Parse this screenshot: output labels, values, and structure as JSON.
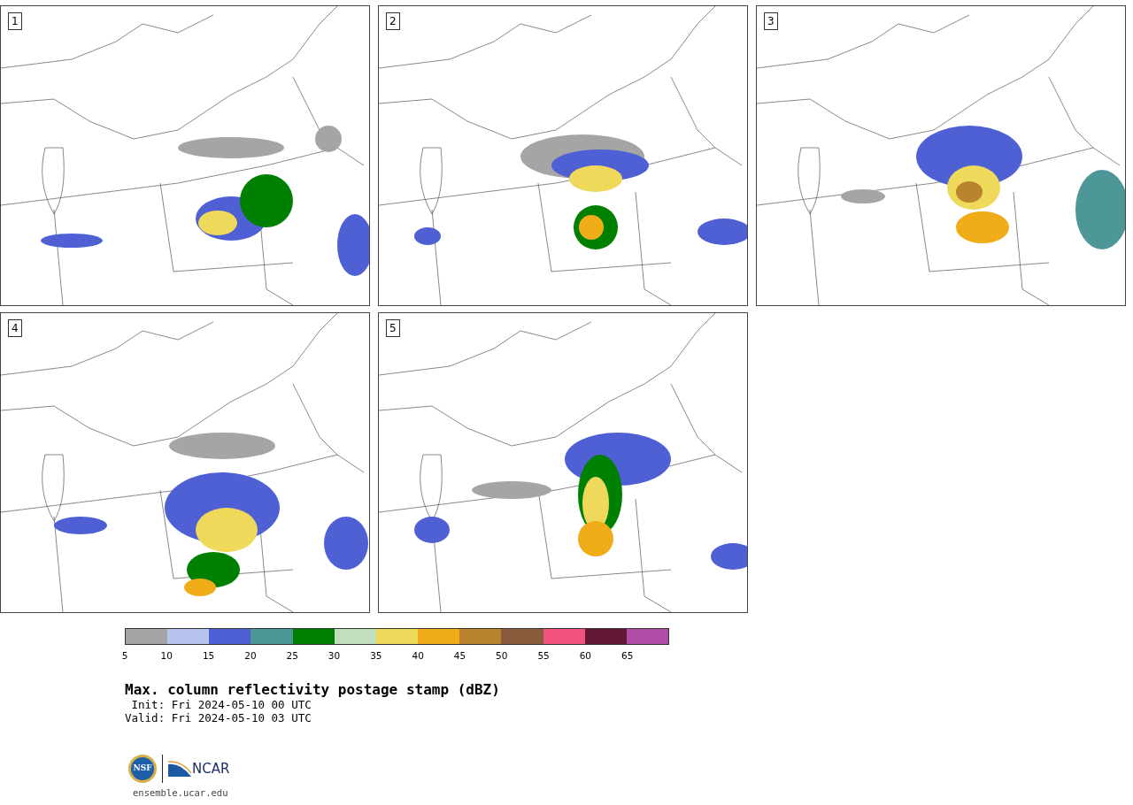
{
  "panels": [
    {
      "label": "1"
    },
    {
      "label": "2"
    },
    {
      "label": "3"
    },
    {
      "label": "4"
    },
    {
      "label": "5"
    }
  ],
  "colorbar": {
    "segments": [
      {
        "color": "#a5a5a5"
      },
      {
        "color": "#b7c3ec"
      },
      {
        "color": "#4f5fd4"
      },
      {
        "color": "#4e9799"
      },
      {
        "color": "#008000"
      },
      {
        "color": "#bfdfbd"
      },
      {
        "color": "#eed95a"
      },
      {
        "color": "#f0ad18"
      },
      {
        "color": "#ba842f"
      },
      {
        "color": "#8b5b3e"
      },
      {
        "color": "#f3517f"
      },
      {
        "color": "#611735"
      },
      {
        "color": "#b04ba6"
      }
    ],
    "ticks": [
      "5",
      "10",
      "15",
      "20",
      "25",
      "30",
      "35",
      "40",
      "45",
      "50",
      "55",
      "60",
      "65"
    ]
  },
  "title": "Max. column reflectivity postage stamp (dBZ)",
  "init": " Init: Fri 2024-05-10 00 UTC",
  "valid": "Valid: Fri 2024-05-10 03 UTC",
  "logo": {
    "nsf": "NSF",
    "ncar": "NCAR"
  },
  "footer": "ensemble.ucar.edu"
}
